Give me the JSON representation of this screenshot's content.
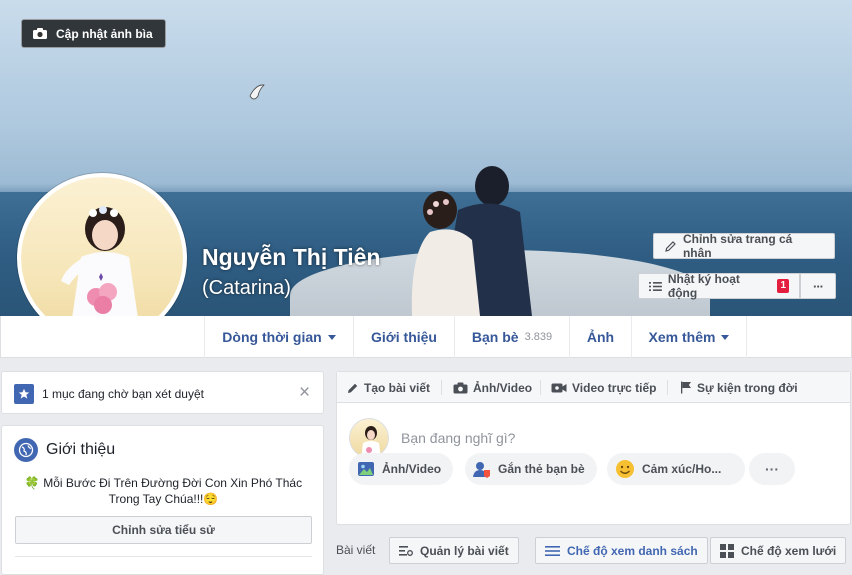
{
  "cover": {
    "update_cover_label": "Cập nhật ảnh bìa",
    "name": "Nguyễn Thị Tiên",
    "alternate_name": "(Catarina)",
    "edit_profile_label": "Chỉnh sửa trang cá nhân",
    "activity_log_label": "Nhật ký hoạt động",
    "activity_log_badge": "1",
    "more_label": "···"
  },
  "nav": {
    "items": [
      {
        "label": "Dòng thời gian"
      },
      {
        "label": "Giới thiệu"
      },
      {
        "label": "Bạn bè",
        "count": "3.839"
      },
      {
        "label": "Ảnh"
      },
      {
        "label": "Xem thêm"
      }
    ]
  },
  "pending": {
    "text": "1 mục đang chờ bạn xét duyệt",
    "close_label": "×"
  },
  "intro": {
    "title": "Giới thiệu",
    "bio_line1": "Mỗi Bước Đi Trên Đường Đời Con Xin Phó Thác",
    "bio_line2": "Trong Tay Chúa!!!",
    "bio_emoji": "😌",
    "leaf_emoji": "🍀",
    "edit_bio_label": "Chỉnh sửa tiểu sử"
  },
  "composer": {
    "tabs": [
      {
        "label": "Tạo bài viết"
      },
      {
        "label": "Ảnh/Video"
      },
      {
        "label": "Video trực tiếp"
      },
      {
        "label": "Sự kiện trong đời"
      }
    ],
    "placeholder": "Bạn đang nghĩ gì?",
    "actions": [
      {
        "label": "Ảnh/Video"
      },
      {
        "label": "Gắn thẻ bạn bè"
      },
      {
        "label": "Cảm xúc/Ho..."
      }
    ],
    "more_label": "···"
  },
  "posts_bar": {
    "label": "Bài viết",
    "manage_label": "Quản lý bài viết",
    "list_view_label": "Chế độ xem danh sách",
    "grid_view_label": "Chế độ xem lưới"
  },
  "colors": {
    "facebook_blue": "#365899",
    "accent_blue": "#4267b2",
    "badge_red": "#e41e3f",
    "page_bg": "#e9ebee"
  }
}
